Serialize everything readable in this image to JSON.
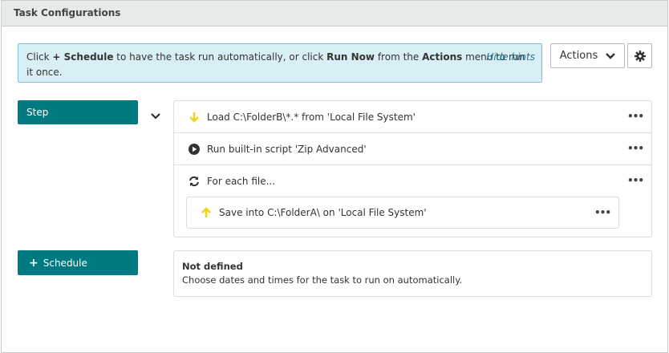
{
  "header": {
    "title": "Task Configurations"
  },
  "hint": {
    "p1": "Click ",
    "b1": "+ Schedule",
    "p2": " to have the task run automatically, or click ",
    "b2": "Run Now",
    "p3": " from the ",
    "b3": "Actions",
    "p4": " menu to run it once.",
    "hide": "Hide hints"
  },
  "toolbar": {
    "actions": "Actions"
  },
  "step": {
    "label": "Step"
  },
  "steps": [
    {
      "text": "Load C:\\FolderB\\*.* from 'Local File System'",
      "icon": "arrow-down-icon"
    },
    {
      "text": "Run built-in script 'Zip Advanced'",
      "icon": "play-circle-icon"
    },
    {
      "text": "For each file...",
      "icon": "refresh-icon"
    },
    {
      "text": "Save into C:\\FolderA\\ on 'Local File System'",
      "icon": "arrow-up-icon"
    }
  ],
  "schedule": {
    "label": "Schedule",
    "title": "Not defined",
    "desc": "Choose dates and times for the task to run on automatically."
  },
  "colors": {
    "accent": "#017980",
    "arrow": "#f2d31b"
  }
}
